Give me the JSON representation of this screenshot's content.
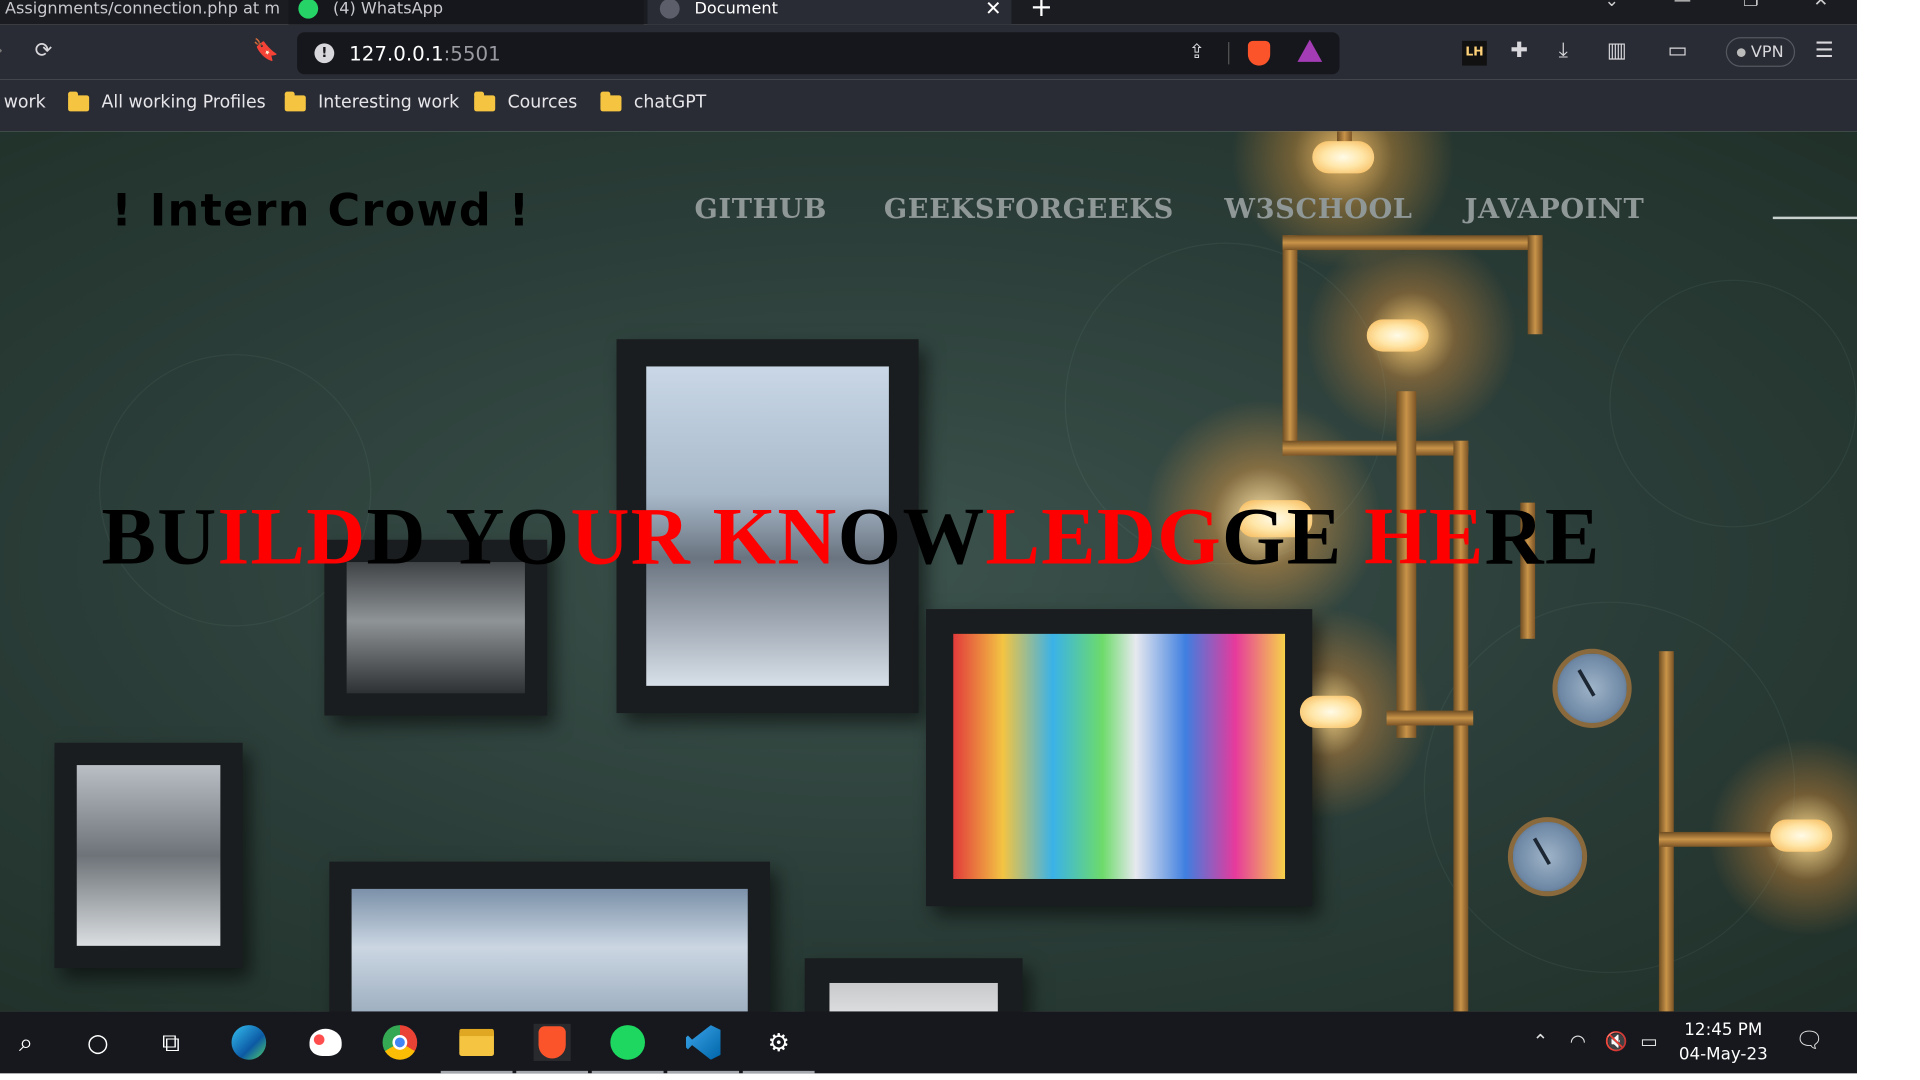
{
  "browser": {
    "tabs": [
      {
        "label": "Assignments/connection.php at m",
        "active": false
      },
      {
        "label": "(4) WhatsApp",
        "active": false
      },
      {
        "label": "Document",
        "active": true
      }
    ],
    "address": {
      "host": "127.0.0.1",
      "port": ":5501"
    },
    "vpn_label": "VPN",
    "lh_label": "LH",
    "bookmarks": [
      {
        "label": "work",
        "folder": false
      },
      {
        "label": "All working Profiles",
        "folder": true
      },
      {
        "label": "Interesting work",
        "folder": true
      },
      {
        "label": "Cources",
        "folder": true
      },
      {
        "label": "chatGPT",
        "folder": true
      }
    ]
  },
  "site": {
    "title": "! Intern Crowd !",
    "nav": [
      "GITHUB",
      "GEEKSFORGEEKS",
      "W3SCHOOL",
      "JAVAPOINT"
    ],
    "hero_segments": [
      {
        "text": "BU",
        "color": "#000000"
      },
      {
        "text": "ILD",
        "color": "#ff0000"
      },
      {
        "text": "D",
        "color": "#000000"
      },
      {
        "text": " YO",
        "color": "#000000"
      },
      {
        "text": "UR KN",
        "color": "#ff0000"
      },
      {
        "text": "OW",
        "color": "#000000"
      },
      {
        "text": "LEDG",
        "color": "#ff0000"
      },
      {
        "text": "GE ",
        "color": "#000000"
      },
      {
        "text": "HE",
        "color": "#ff0000"
      },
      {
        "text": "RE",
        "color": "#000000"
      }
    ]
  },
  "taskbar": {
    "apps": [
      "search-icon",
      "cortana-icon",
      "task-view-icon",
      "edge-icon",
      "paint-icon",
      "chrome-icon",
      "file-explorer-icon",
      "brave-icon",
      "spotify-icon",
      "vscode-icon",
      "settings-icon"
    ],
    "time": "12:45 PM",
    "date": "04-May-23"
  }
}
